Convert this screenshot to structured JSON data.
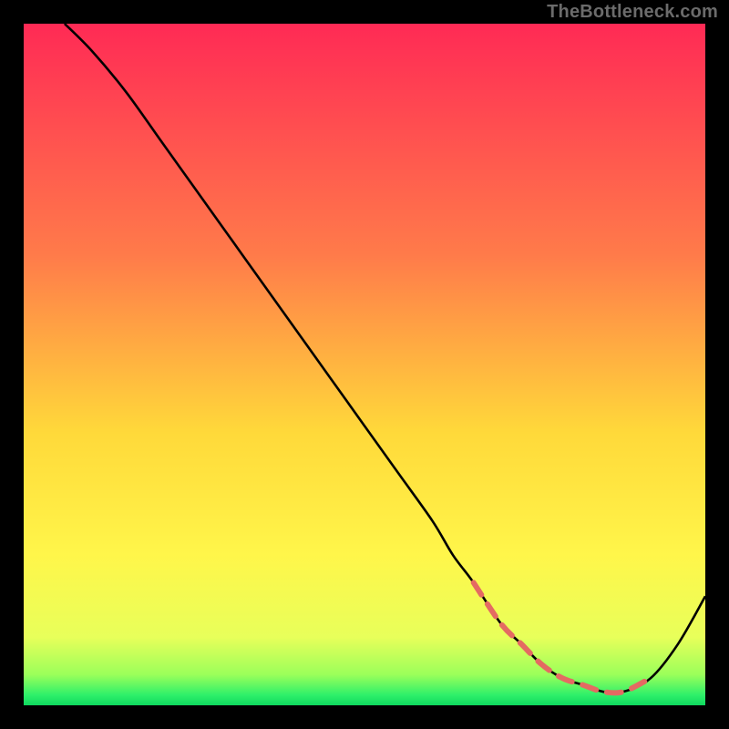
{
  "watermark": "TheBottleneck.com",
  "chart_data": {
    "type": "line",
    "title": "",
    "xlabel": "",
    "ylabel": "",
    "xlim": [
      0,
      100
    ],
    "ylim": [
      0,
      100
    ],
    "x": [
      6,
      10,
      15,
      20,
      25,
      30,
      35,
      40,
      45,
      50,
      55,
      60,
      63,
      66,
      70,
      73,
      76,
      79,
      82,
      85,
      88,
      92,
      96,
      100
    ],
    "values": [
      100,
      96,
      90,
      83,
      76,
      69,
      62,
      55,
      48,
      41,
      34,
      27,
      22,
      18,
      12,
      9,
      6,
      4,
      3,
      2,
      2,
      4,
      9,
      16
    ],
    "dash_segment": {
      "x_start": 66,
      "x_end": 92
    },
    "gradient_stops": [
      {
        "offset": 0.0,
        "color": "#ff2a55"
      },
      {
        "offset": 0.34,
        "color": "#ff7b4a"
      },
      {
        "offset": 0.6,
        "color": "#ffd93a"
      },
      {
        "offset": 0.78,
        "color": "#fff64a"
      },
      {
        "offset": 0.9,
        "color": "#e8ff5a"
      },
      {
        "offset": 0.955,
        "color": "#9bff5a"
      },
      {
        "offset": 0.985,
        "color": "#2ef06a"
      },
      {
        "offset": 1.0,
        "color": "#0fd85f"
      }
    ],
    "colors": {
      "line": "#000000",
      "dash": "#e46a62"
    }
  }
}
